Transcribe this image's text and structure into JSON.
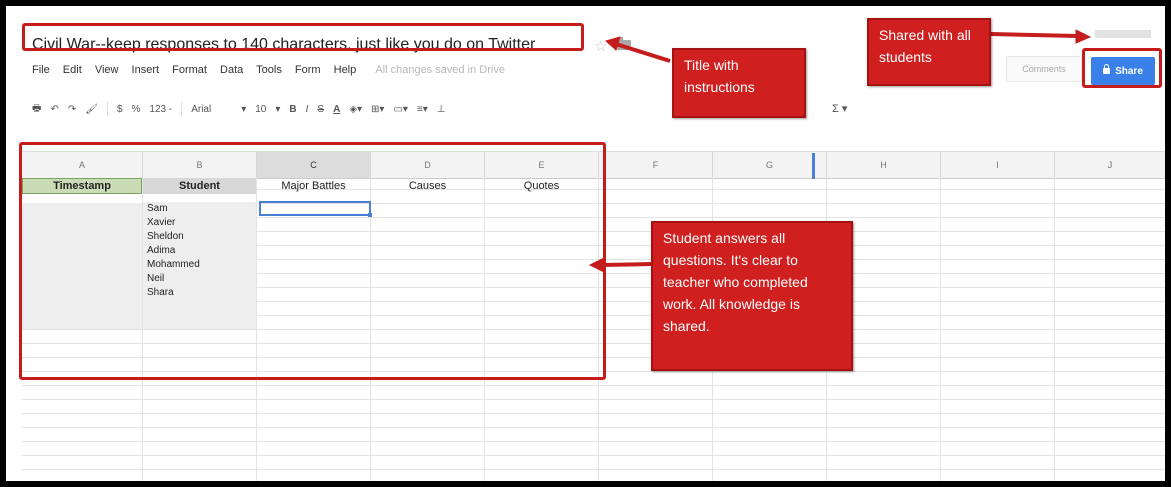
{
  "document": {
    "title": "Civil War--keep responses to 140 characters, just like you do on Twitter",
    "saved_status": "All changes saved in Drive"
  },
  "menu": [
    "File",
    "Edit",
    "View",
    "Insert",
    "Format",
    "Data",
    "Tools",
    "Form",
    "Help"
  ],
  "toolbar": {
    "currency": "$",
    "percent": "%",
    "number_format": "123 -",
    "font": "Arial",
    "font_size": "10",
    "bold": "B",
    "italic": "I",
    "strike": "S",
    "text_color": "A"
  },
  "header_buttons": {
    "comments": "Comments",
    "share": "Share"
  },
  "columns": [
    "A",
    "B",
    "C",
    "D",
    "E",
    "F",
    "G",
    "H",
    "I",
    "J"
  ],
  "sheet_headers": {
    "timestamp": "Timestamp",
    "student": "Student",
    "major_battles": "Major Battles",
    "causes": "Causes",
    "quotes": "Quotes"
  },
  "students": [
    "Sam",
    "Xavier",
    "Sheldon",
    "Adima",
    "Mohammed",
    "Neil",
    "Shara"
  ],
  "callouts": {
    "title": "Title with instructions",
    "shared": "Shared with all students",
    "student_answers": "Student answers all questions. It's clear to teacher who completed work. All knowledge is shared."
  },
  "colors": {
    "annotation_red": "#cf1f1f",
    "share_blue": "#3a80e9",
    "timestamp_green": "#c9dcb6"
  }
}
